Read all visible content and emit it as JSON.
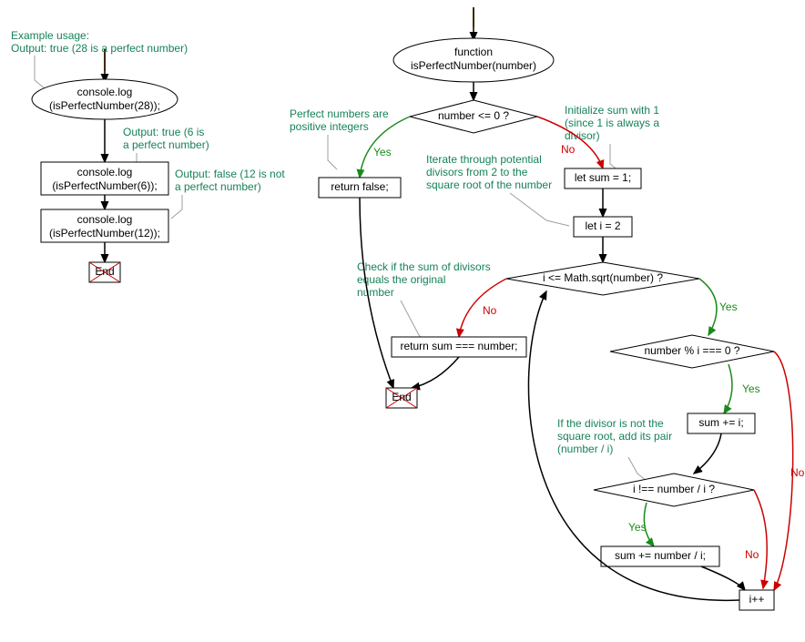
{
  "left": {
    "comment_usage": "Example usage:",
    "comment_true28": "Output: true (28 is a perfect number)",
    "comment_true6_l1": "Output: true (6 is",
    "comment_true6_l2": "a perfect number)",
    "comment_false12_l1": "Output: false (12 is not",
    "comment_false12_l2": "a perfect number)",
    "log28_l1": "console.log",
    "log28_l2": "(isPerfectNumber(28));",
    "log6_l1": "console.log",
    "log6_l2": "(isPerfectNumber(6));",
    "log12_l1": "console.log",
    "log12_l2": "(isPerfectNumber(12));",
    "end": "End"
  },
  "right": {
    "func_l1": "function",
    "func_l2": "isPerfectNumber(number)",
    "dec_le0": "number <= 0 ?",
    "comment_positive_l1": "Perfect numbers are",
    "comment_positive_l2": "positive integers",
    "ret_false": "return false;",
    "comment_init_l1": "Initialize sum with 1",
    "comment_init_l2": "(since 1 is always a",
    "comment_init_l3": "divisor)",
    "let_sum": "let sum = 1;",
    "let_i": "let i = 2",
    "comment_iterate_l1": "Iterate through potential",
    "comment_iterate_l2": "divisors from 2 to the",
    "comment_iterate_l3": "square root of the number",
    "dec_loop": "i <= Math.sqrt(number) ?",
    "dec_mod": "number % i === 0 ?",
    "sum_i": "sum += i;",
    "comment_pair_l1": "If the divisor is not the",
    "comment_pair_l2": "square root, add its pair",
    "comment_pair_l3": "(number / i)",
    "dec_neq": "i !== number / i ?",
    "sum_pair": "sum += number / i;",
    "ipp": "i++",
    "comment_check_l1": "Check if the sum of divisors",
    "comment_check_l2": "equals the original",
    "comment_check_l3": "number",
    "ret_eq": "return sum === number;",
    "end": "End"
  },
  "labels": {
    "yes": "Yes",
    "no": "No"
  }
}
